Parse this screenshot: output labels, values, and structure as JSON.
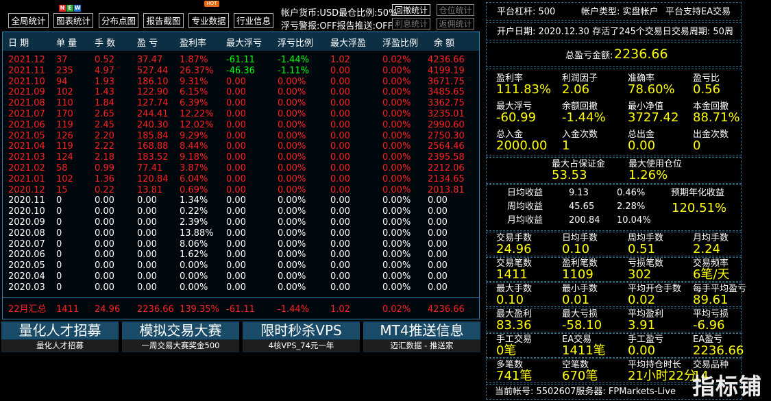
{
  "toolbar": {
    "buttons": [
      "全局统计",
      "图表统计",
      "分布点图",
      "报告截图",
      "专业数据",
      "行业信息"
    ],
    "new_badge": [
      "N",
      "E",
      "W"
    ],
    "hot_badge": "HOT",
    "account_currency": "帐户货币:USD最仓比例:50%",
    "float_alarm": "浮亏警报:OFF报告推送:OFF",
    "btn_withdraw_stats": "回撤统计",
    "btn_position_stats": "仓位统计",
    "btn_interest_stats": "利息统计",
    "btn_rebate_stats": "返佣统计"
  },
  "table": {
    "headers": [
      "日 期",
      "单 量",
      "手 数",
      "盈 亏",
      "盈利率",
      "最大浮亏",
      "浮亏比例",
      "最大浮盈",
      "浮盈比例",
      "余 额"
    ],
    "rows": [
      [
        "2021.12",
        "37",
        "0.52",
        "37.47",
        "1.87%",
        "-61.11",
        "-1.44%",
        "1.02",
        "0.02%",
        "4236.66"
      ],
      [
        "2021.11",
        "235",
        "4.97",
        "527.44",
        "26.37%",
        "-46.36",
        "-1.11%",
        "0.00",
        "0.00%",
        "4199.19"
      ],
      [
        "2021.10",
        "94",
        "1.93",
        "186.10",
        "9.31%",
        "0.00",
        "0.00%",
        "0.00",
        "0.00%",
        "3671.75"
      ],
      [
        "2021.09",
        "102",
        "1.43",
        "122.90",
        "6.15%",
        "0.00",
        "0.00%",
        "0.00",
        "0.00%",
        "3485.65"
      ],
      [
        "2021.08",
        "110",
        "1.84",
        "127.74",
        "6.39%",
        "0.00",
        "0.00%",
        "0.00",
        "0.00%",
        "3362.75"
      ],
      [
        "2021.07",
        "170",
        "2.65",
        "244.41",
        "12.22%",
        "0.00",
        "0.00%",
        "0.00",
        "0.00%",
        "3235.01"
      ],
      [
        "2021.06",
        "119",
        "2.45",
        "240.30",
        "12.02%",
        "0.00",
        "0.00%",
        "0.00",
        "0.00%",
        "2990.60"
      ],
      [
        "2021.05",
        "126",
        "2.20",
        "185.84",
        "9.29%",
        "0.00",
        "0.00%",
        "0.00",
        "0.00%",
        "2750.30"
      ],
      [
        "2021.04",
        "119",
        "2.22",
        "168.88",
        "8.44%",
        "0.00",
        "0.00%",
        "0.00",
        "0.00%",
        "2564.46"
      ],
      [
        "2021.03",
        "124",
        "2.18",
        "183.52",
        "9.18%",
        "0.00",
        "0.00%",
        "0.00",
        "0.00%",
        "2395.58"
      ],
      [
        "2021.02",
        "58",
        "0.99",
        "77.41",
        "3.87%",
        "0.00",
        "0.00%",
        "0.00",
        "0.00%",
        "2212.06"
      ],
      [
        "2021.01",
        "102",
        "1.36",
        "120.84",
        "6.04%",
        "0.00",
        "0.00%",
        "0.00",
        "0.00%",
        "2134.65"
      ],
      [
        "2020.12",
        "15",
        "0.22",
        "13.81",
        "0.69%",
        "0.00",
        "0.00%",
        "0.00",
        "0.00%",
        "2013.81"
      ],
      [
        "2020.11",
        "0",
        "0.00",
        "0.00",
        "1.34%",
        "0.00",
        "0.00%",
        "0.00",
        "0.00%",
        "0.00"
      ],
      [
        "2020.10",
        "0",
        "0.00",
        "0.00",
        "0.22%",
        "0.00",
        "0.00%",
        "0.00",
        "0.00%",
        "0.00"
      ],
      [
        "2020.09",
        "0",
        "0.00",
        "0.00",
        "2.39%",
        "0.00",
        "0.00%",
        "0.00",
        "0.00%",
        "0.00"
      ],
      [
        "2020.08",
        "0",
        "0.00",
        "0.00",
        "13.88%",
        "0.00",
        "0.00%",
        "0.00",
        "0.00%",
        "0.00"
      ],
      [
        "2020.07",
        "0",
        "0.00",
        "0.00",
        "8.06%",
        "0.00",
        "0.00%",
        "0.00",
        "0.00%",
        "0.00"
      ],
      [
        "2020.06",
        "0",
        "0.00",
        "0.00",
        "1.62%",
        "0.00",
        "0.00%",
        "0.00",
        "0.00%",
        "0.00"
      ],
      [
        "2020.05",
        "0",
        "0.00",
        "0.00",
        "0.00%",
        "0.00",
        "0.00%",
        "0.00",
        "0.00%",
        "0.00"
      ],
      [
        "2020.04",
        "0",
        "0.00",
        "0.00",
        "0.00%",
        "0.00",
        "0.00%",
        "0.00",
        "0.00%",
        "0.00"
      ],
      [
        "2020.03",
        "0",
        "0.00",
        "0.00",
        "0.00%",
        "0.00",
        "0.00%",
        "0.00",
        "0.00%",
        "0.00"
      ]
    ],
    "summary": [
      "22月汇总",
      "1411",
      "24.96",
      "2236.66",
      "139.35%",
      "-61.11",
      "-1.44%",
      "1.02",
      "0.02%",
      "4236.66"
    ],
    "colors": {
      "profit": "#ff2020",
      "neutral": "#ffffff",
      "drawdown": "#00ff00",
      "summary": "#ff2020"
    }
  },
  "banners": [
    {
      "title": "量化人才招募",
      "sub": "量化人才招募"
    },
    {
      "title": "模拟交易大赛",
      "sub": "一周交易大赛奖金500"
    },
    {
      "title": "限时秒杀VPS",
      "sub": "4核VPS_74元一年"
    },
    {
      "title": "MT4推送信息",
      "sub": "迈汇数据 - 推送家"
    }
  ],
  "panel": {
    "leverage": "平台杠杆:  500",
    "account_type": "帐户类型:  实盘帐户",
    "ea_support": "平台支持EA交易",
    "open_info": "开户日期:  2020.12.30  存活了245个交易日交易周期:  50周",
    "total_pnl_label": "总盈亏金额:",
    "total_pnl_value": "2236.66",
    "stats_rows": [
      [
        {
          "l": "盈利率",
          "v": "111.83%"
        },
        {
          "l": "利润因子",
          "v": "2.06"
        },
        {
          "l": "准确率",
          "v": "78.60%"
        },
        {
          "l": "盈亏比",
          "v": "0.56"
        }
      ],
      [
        {
          "l": "最大浮亏",
          "v": "-60.99"
        },
        {
          "l": "余额回撤",
          "v": "-1.44%"
        },
        {
          "l": "最小净值",
          "v": "3727.42"
        },
        {
          "l": "本金回撤",
          "v": "88.71%"
        }
      ],
      [
        {
          "l": "总入金",
          "v": "2000.00"
        },
        {
          "l": "入金次数",
          "v": "1"
        },
        {
          "l": "总出金",
          "v": "0.00"
        },
        {
          "l": "出金次数",
          "v": "0"
        }
      ]
    ],
    "margin": {
      "max_margin_label": "最大占保证金",
      "max_margin_value": "53.53",
      "max_pos_label": "最大使用仓位",
      "max_pos_value": "1.26%"
    },
    "income": {
      "rows": [
        {
          "label": "日均收益",
          "amount": "9.13",
          "pct": "0.46%"
        },
        {
          "label": "周均收益",
          "amount": "45.65",
          "pct": "2.28%"
        },
        {
          "label": "月均收益",
          "amount": "200.84",
          "pct": "10.04%"
        }
      ],
      "annual_label": "预期年化收益",
      "annual_value": "120.51%"
    },
    "trade_rows": [
      [
        {
          "l": "交易手数",
          "v": "24.96"
        },
        {
          "l": "日均手数",
          "v": "0.10"
        },
        {
          "l": "周均手数",
          "v": "0.51"
        },
        {
          "l": "月均手数",
          "v": "2.24"
        }
      ],
      [
        {
          "l": "交易笔数",
          "v": "1411"
        },
        {
          "l": "盈利笔数",
          "v": "1109"
        },
        {
          "l": "亏损笔数",
          "v": "302"
        },
        {
          "l": "交易频率",
          "v": "6笔/天"
        }
      ],
      [
        {
          "l": "最大手数",
          "v": "0.10"
        },
        {
          "l": "最小手数",
          "v": "0.01"
        },
        {
          "l": "平均开仓手数",
          "v": "0.02"
        },
        {
          "l": "每手平均盈亏",
          "v": "89.61"
        }
      ],
      [
        {
          "l": "最大盈利",
          "v": "83.36"
        },
        {
          "l": "最大亏损",
          "v": "-58.10"
        },
        {
          "l": "平均盈利",
          "v": "3.91"
        },
        {
          "l": "平均亏损",
          "v": "-6.96"
        }
      ],
      [
        {
          "l": "手工交易",
          "v": "0笔"
        },
        {
          "l": "EA交易",
          "v": "1411笔"
        },
        {
          "l": "手工盈亏",
          "v": "0.00"
        },
        {
          "l": "EA盈亏",
          "v": "2236.66"
        }
      ],
      [
        {
          "l": "多笔数",
          "v": "741笔"
        },
        {
          "l": "空笔数",
          "v": "670笔"
        },
        {
          "l": "平均持仓时长",
          "v": "21小时22分"
        },
        {
          "l": "交易品种",
          "v": "14"
        }
      ]
    ],
    "footer": "当前帐号:  5502607服务器:  FPMarkets-Live"
  },
  "watermark": "指标铺"
}
